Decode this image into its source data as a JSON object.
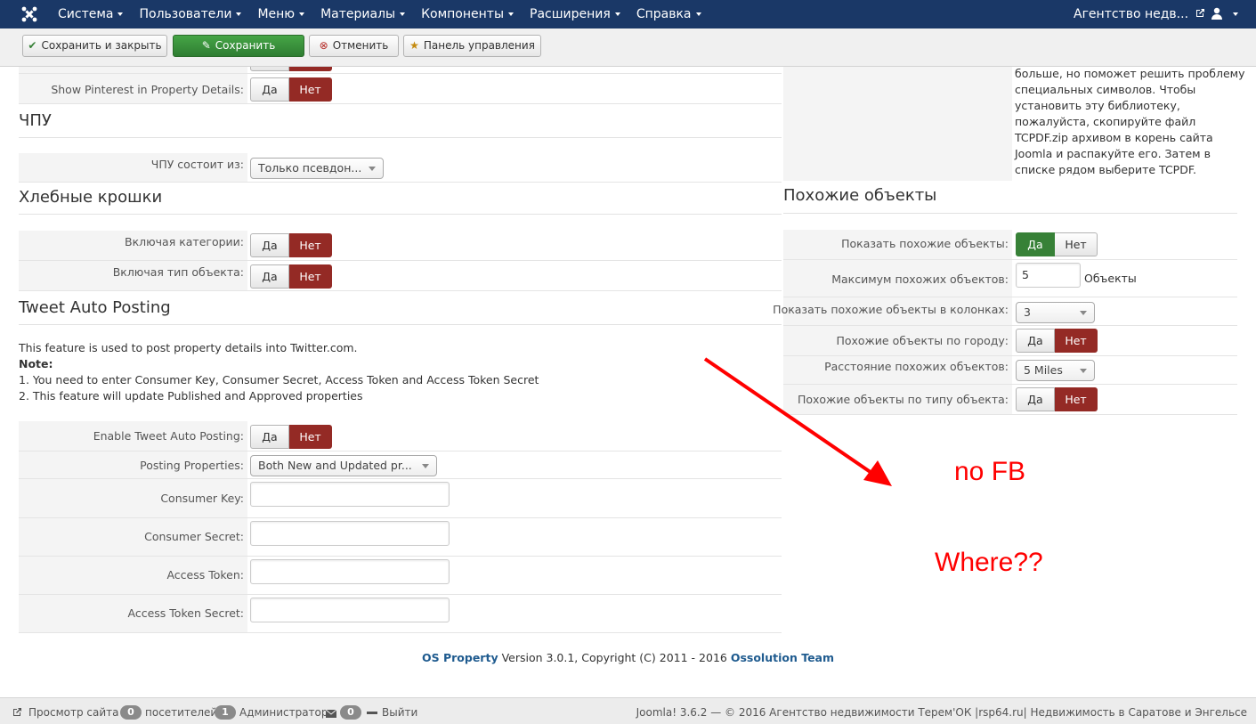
{
  "navbar": {
    "menu": [
      "Система",
      "Пользователи",
      "Меню",
      "Материалы",
      "Компоненты",
      "Расширения",
      "Справка"
    ],
    "site_link": "Агентство недв..."
  },
  "toolbar": {
    "save_close": "Сохранить и закрыть",
    "save": "Сохранить",
    "cancel": "Отменить",
    "dashboard": "Панель управления"
  },
  "left": {
    "pinterest_label": "Show Pinterest in Property Details:",
    "sef_heading": "ЧПУ",
    "sef_label": "ЧПУ состоит из:",
    "sef_value": "Только псевдон...",
    "breadcrumbs_heading": "Хлебные крошки",
    "include_categories_label": "Включая категории:",
    "include_type_label": "Включая тип объекта:",
    "tweet_heading": "Tweet Auto Posting",
    "tweet_desc": "This feature is used to post property details into Twitter.com.",
    "note_label": "Note:",
    "note_1": "1. You need to enter Consumer Key, Consumer Secret, Access Token and Access Token Secret",
    "note_2": "2. This feature will update Published and Approved properties",
    "enable_tweet_label": "Enable Tweet Auto Posting:",
    "posting_properties_label": "Posting Properties:",
    "posting_properties_value": "Both New and Updated pr...",
    "consumer_key_label": "Consumer Key:",
    "consumer_secret_label": "Consumer Secret:",
    "access_token_label": "Access Token:",
    "access_token_secret_label": "Access Token Secret:"
  },
  "toggle": {
    "yes": "Да",
    "no": "Нет"
  },
  "right": {
    "tcpdf_lines": [
      "больше, но поможет решить проблему",
      "специальных символов. Чтобы",
      "установить эту библиотеку,",
      "пожалуйста, скопируйте файл",
      "TCPDF.zip архивом в корень сайта",
      "Joomla и распакуйте его. Затем в",
      "списке рядом выберите TCPDF."
    ],
    "similar_heading": "Похожие объекты",
    "show_similar_label": "Показать похожие объекты:",
    "max_similar_label": "Максимум похожих объектов:",
    "max_similar_value": "5",
    "max_similar_unit": "Объекты",
    "columns_label": "Показать похожие объекты в колонках:",
    "columns_value": "3",
    "by_city_label": "Похожие объекты по городу:",
    "distance_label": "Расстояние похожих объектов:",
    "distance_value": "5 Miles",
    "by_type_label": "Похожие объекты по типу объекта:"
  },
  "annotations": {
    "no_fb": "no FB",
    "where": "Where??",
    "color": "#ff0000"
  },
  "credit": {
    "product": "OS Property",
    "version_text": " Version 3.0.1, Copyright (C) 2011 - 2016 ",
    "team": "Ossolution Team"
  },
  "status": {
    "view_site": "Просмотр сайта",
    "visitors_count": "0",
    "visitors_label": "посетителей",
    "admins_count": "1",
    "admins_label": "Администратор",
    "messages_count": "0",
    "logout": "Выйти",
    "right_text": "Joomla! 3.6.2  —  © 2016 Агентство недвижимости Терем'ОК |rsp64.ru| Недвижимость в Саратове и Энгельсе"
  },
  "colors": {
    "navbar": "#1a3867",
    "save_green": "#378137",
    "no_red": "#942a25",
    "link_blue": "#1f5b8f"
  }
}
